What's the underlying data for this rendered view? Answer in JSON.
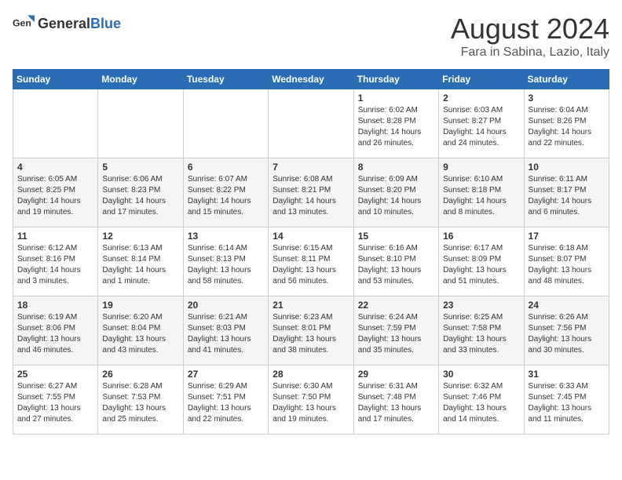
{
  "header": {
    "logo_general": "General",
    "logo_blue": "Blue",
    "month_year": "August 2024",
    "location": "Fara in Sabina, Lazio, Italy"
  },
  "columns": [
    "Sunday",
    "Monday",
    "Tuesday",
    "Wednesday",
    "Thursday",
    "Friday",
    "Saturday"
  ],
  "weeks": [
    [
      {
        "day": "",
        "sunrise": "",
        "sunset": "",
        "daylight": ""
      },
      {
        "day": "",
        "sunrise": "",
        "sunset": "",
        "daylight": ""
      },
      {
        "day": "",
        "sunrise": "",
        "sunset": "",
        "daylight": ""
      },
      {
        "day": "",
        "sunrise": "",
        "sunset": "",
        "daylight": ""
      },
      {
        "day": "1",
        "sunrise": "Sunrise: 6:02 AM",
        "sunset": "Sunset: 8:28 PM",
        "daylight": "Daylight: 14 hours and 26 minutes."
      },
      {
        "day": "2",
        "sunrise": "Sunrise: 6:03 AM",
        "sunset": "Sunset: 8:27 PM",
        "daylight": "Daylight: 14 hours and 24 minutes."
      },
      {
        "day": "3",
        "sunrise": "Sunrise: 6:04 AM",
        "sunset": "Sunset: 8:26 PM",
        "daylight": "Daylight: 14 hours and 22 minutes."
      }
    ],
    [
      {
        "day": "4",
        "sunrise": "Sunrise: 6:05 AM",
        "sunset": "Sunset: 8:25 PM",
        "daylight": "Daylight: 14 hours and 19 minutes."
      },
      {
        "day": "5",
        "sunrise": "Sunrise: 6:06 AM",
        "sunset": "Sunset: 8:23 PM",
        "daylight": "Daylight: 14 hours and 17 minutes."
      },
      {
        "day": "6",
        "sunrise": "Sunrise: 6:07 AM",
        "sunset": "Sunset: 8:22 PM",
        "daylight": "Daylight: 14 hours and 15 minutes."
      },
      {
        "day": "7",
        "sunrise": "Sunrise: 6:08 AM",
        "sunset": "Sunset: 8:21 PM",
        "daylight": "Daylight: 14 hours and 13 minutes."
      },
      {
        "day": "8",
        "sunrise": "Sunrise: 6:09 AM",
        "sunset": "Sunset: 8:20 PM",
        "daylight": "Daylight: 14 hours and 10 minutes."
      },
      {
        "day": "9",
        "sunrise": "Sunrise: 6:10 AM",
        "sunset": "Sunset: 8:18 PM",
        "daylight": "Daylight: 14 hours and 8 minutes."
      },
      {
        "day": "10",
        "sunrise": "Sunrise: 6:11 AM",
        "sunset": "Sunset: 8:17 PM",
        "daylight": "Daylight: 14 hours and 6 minutes."
      }
    ],
    [
      {
        "day": "11",
        "sunrise": "Sunrise: 6:12 AM",
        "sunset": "Sunset: 8:16 PM",
        "daylight": "Daylight: 14 hours and 3 minutes."
      },
      {
        "day": "12",
        "sunrise": "Sunrise: 6:13 AM",
        "sunset": "Sunset: 8:14 PM",
        "daylight": "Daylight: 14 hours and 1 minute."
      },
      {
        "day": "13",
        "sunrise": "Sunrise: 6:14 AM",
        "sunset": "Sunset: 8:13 PM",
        "daylight": "Daylight: 13 hours and 58 minutes."
      },
      {
        "day": "14",
        "sunrise": "Sunrise: 6:15 AM",
        "sunset": "Sunset: 8:11 PM",
        "daylight": "Daylight: 13 hours and 56 minutes."
      },
      {
        "day": "15",
        "sunrise": "Sunrise: 6:16 AM",
        "sunset": "Sunset: 8:10 PM",
        "daylight": "Daylight: 13 hours and 53 minutes."
      },
      {
        "day": "16",
        "sunrise": "Sunrise: 6:17 AM",
        "sunset": "Sunset: 8:09 PM",
        "daylight": "Daylight: 13 hours and 51 minutes."
      },
      {
        "day": "17",
        "sunrise": "Sunrise: 6:18 AM",
        "sunset": "Sunset: 8:07 PM",
        "daylight": "Daylight: 13 hours and 48 minutes."
      }
    ],
    [
      {
        "day": "18",
        "sunrise": "Sunrise: 6:19 AM",
        "sunset": "Sunset: 8:06 PM",
        "daylight": "Daylight: 13 hours and 46 minutes."
      },
      {
        "day": "19",
        "sunrise": "Sunrise: 6:20 AM",
        "sunset": "Sunset: 8:04 PM",
        "daylight": "Daylight: 13 hours and 43 minutes."
      },
      {
        "day": "20",
        "sunrise": "Sunrise: 6:21 AM",
        "sunset": "Sunset: 8:03 PM",
        "daylight": "Daylight: 13 hours and 41 minutes."
      },
      {
        "day": "21",
        "sunrise": "Sunrise: 6:23 AM",
        "sunset": "Sunset: 8:01 PM",
        "daylight": "Daylight: 13 hours and 38 minutes."
      },
      {
        "day": "22",
        "sunrise": "Sunrise: 6:24 AM",
        "sunset": "Sunset: 7:59 PM",
        "daylight": "Daylight: 13 hours and 35 minutes."
      },
      {
        "day": "23",
        "sunrise": "Sunrise: 6:25 AM",
        "sunset": "Sunset: 7:58 PM",
        "daylight": "Daylight: 13 hours and 33 minutes."
      },
      {
        "day": "24",
        "sunrise": "Sunrise: 6:26 AM",
        "sunset": "Sunset: 7:56 PM",
        "daylight": "Daylight: 13 hours and 30 minutes."
      }
    ],
    [
      {
        "day": "25",
        "sunrise": "Sunrise: 6:27 AM",
        "sunset": "Sunset: 7:55 PM",
        "daylight": "Daylight: 13 hours and 27 minutes."
      },
      {
        "day": "26",
        "sunrise": "Sunrise: 6:28 AM",
        "sunset": "Sunset: 7:53 PM",
        "daylight": "Daylight: 13 hours and 25 minutes."
      },
      {
        "day": "27",
        "sunrise": "Sunrise: 6:29 AM",
        "sunset": "Sunset: 7:51 PM",
        "daylight": "Daylight: 13 hours and 22 minutes."
      },
      {
        "day": "28",
        "sunrise": "Sunrise: 6:30 AM",
        "sunset": "Sunset: 7:50 PM",
        "daylight": "Daylight: 13 hours and 19 minutes."
      },
      {
        "day": "29",
        "sunrise": "Sunrise: 6:31 AM",
        "sunset": "Sunset: 7:48 PM",
        "daylight": "Daylight: 13 hours and 17 minutes."
      },
      {
        "day": "30",
        "sunrise": "Sunrise: 6:32 AM",
        "sunset": "Sunset: 7:46 PM",
        "daylight": "Daylight: 13 hours and 14 minutes."
      },
      {
        "day": "31",
        "sunrise": "Sunrise: 6:33 AM",
        "sunset": "Sunset: 7:45 PM",
        "daylight": "Daylight: 13 hours and 11 minutes."
      }
    ]
  ]
}
